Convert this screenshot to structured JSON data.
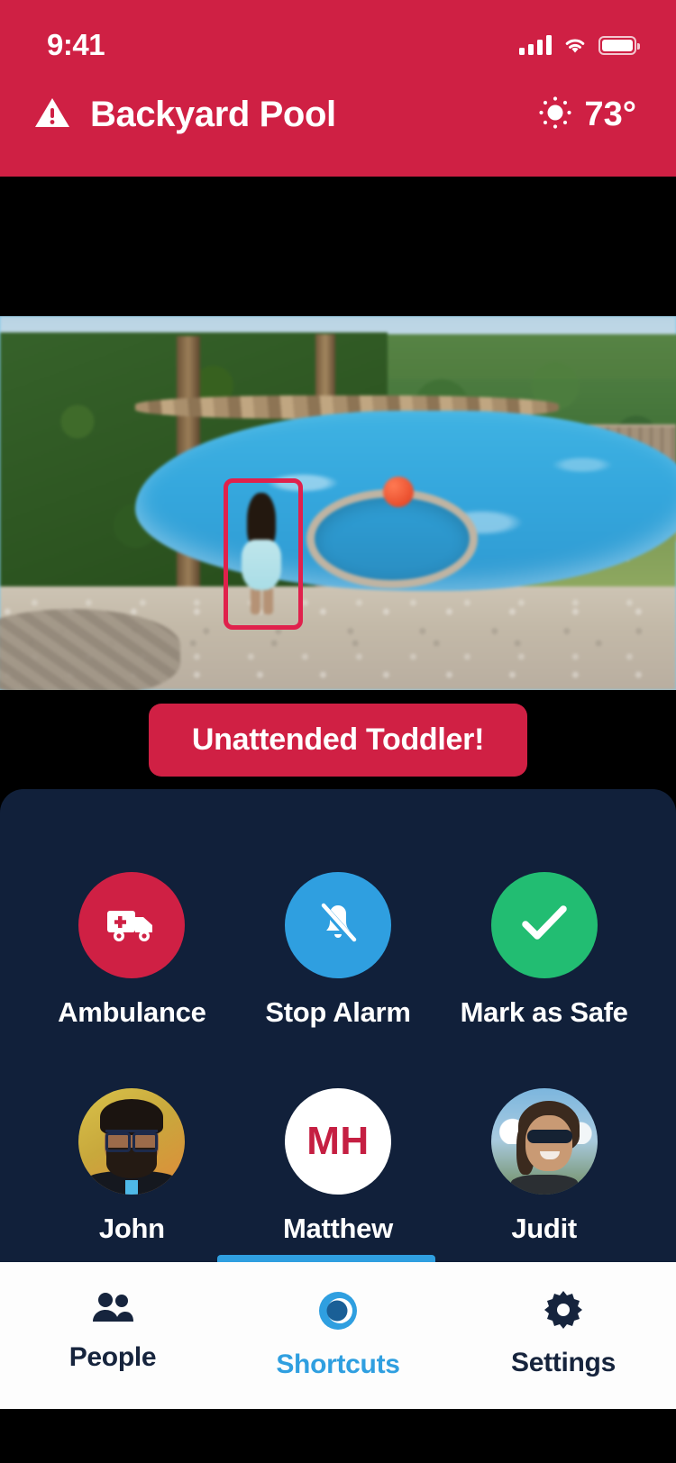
{
  "status_bar": {
    "time": "9:41",
    "signal_icon": "cellular-signal-icon",
    "wifi_icon": "wifi-icon",
    "battery_icon": "battery-icon"
  },
  "header": {
    "alert_icon": "warning-triangle-icon",
    "title": "Backyard Pool",
    "weather_icon": "sun-icon",
    "temperature": "73°",
    "background_color": "#cf2044"
  },
  "video": {
    "detection_box_label": "toddler-detection-box",
    "detection_box_color": "#e0214c",
    "scene_description": "backyard-pool-camera-feed"
  },
  "alert": {
    "text": "Unattended Toddler!",
    "background_color": "#d02044",
    "text_color": "#ffffff"
  },
  "panel": {
    "background_color": "#11203a",
    "actions": [
      {
        "label": "Ambulance",
        "icon": "ambulance-icon",
        "color": "#cf2044"
      },
      {
        "label": "Stop Alarm",
        "icon": "bell-slash-icon",
        "color": "#2f9fe0"
      },
      {
        "label": "Mark as Safe",
        "icon": "checkmark-icon",
        "color": "#22bd72"
      }
    ],
    "contacts": [
      {
        "name": "John",
        "avatar_type": "photo",
        "initials": ""
      },
      {
        "name": "Matthew",
        "avatar_type": "initials",
        "initials": "MH"
      },
      {
        "name": "Judit",
        "avatar_type": "photo",
        "initials": ""
      }
    ]
  },
  "tab_bar": {
    "active_index": 1,
    "active_color": "#2f9fe0",
    "inactive_color": "#16243d",
    "tabs": [
      {
        "label": "People",
        "icon": "people-icon"
      },
      {
        "label": "Shortcuts",
        "icon": "shortcuts-logo-icon"
      },
      {
        "label": "Settings",
        "icon": "gear-icon"
      }
    ]
  }
}
